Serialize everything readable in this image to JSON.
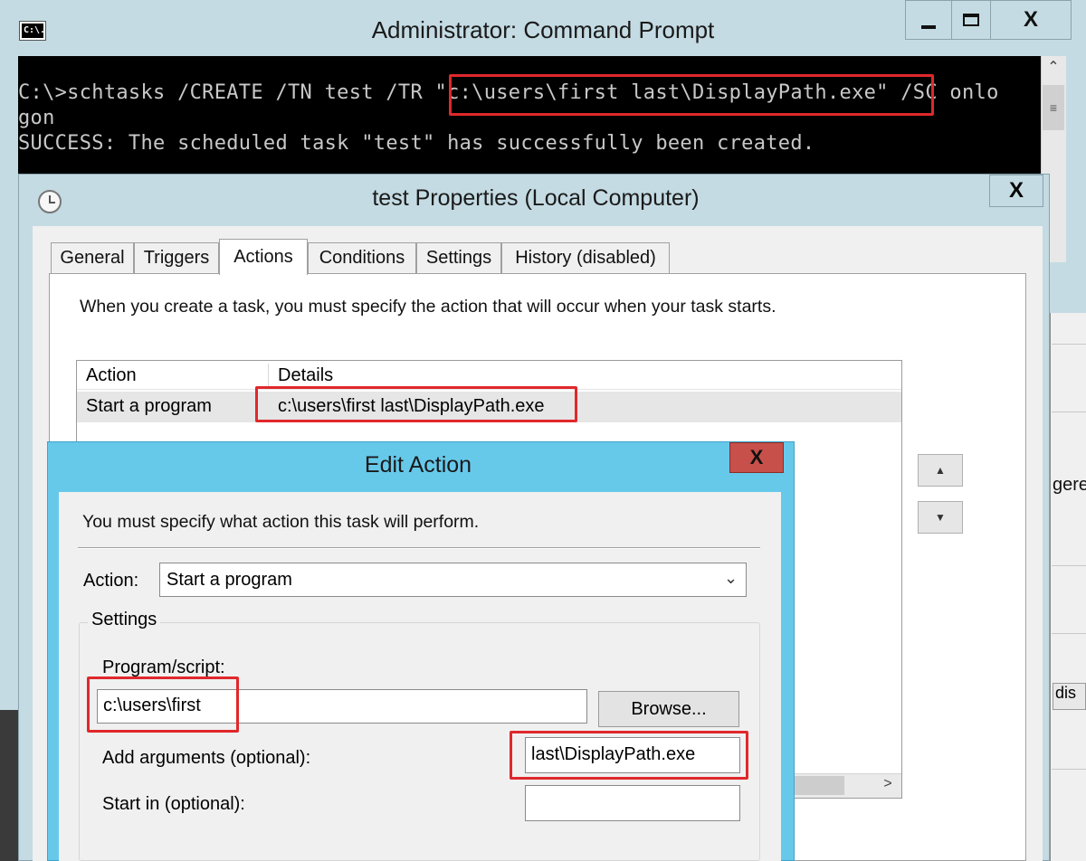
{
  "cmd": {
    "title": "Administrator: Command Prompt",
    "icon_text": "C:\\.",
    "console_lines": [
      "C:\\>schtasks /CREATE /TN test /TR \"c:\\users\\first last\\DisplayPath.exe\" /SC onlo",
      "gon",
      "SUCCESS: The scheduled task \"test\" has successfully been created."
    ],
    "close_glyph": "X"
  },
  "props": {
    "title": "test Properties (Local Computer)",
    "close_glyph": "X",
    "tabs": [
      {
        "label": "General"
      },
      {
        "label": "Triggers"
      },
      {
        "label": "Actions"
      },
      {
        "label": "Conditions"
      },
      {
        "label": "Settings"
      },
      {
        "label": "History (disabled)"
      }
    ],
    "active_tab": "Actions",
    "description": "When you create a task, you must specify the action that will occur when your task starts.",
    "list": {
      "columns": [
        "Action",
        "Details"
      ],
      "rows": [
        {
          "action": "Start a program",
          "details": "c:\\users\\first last\\DisplayPath.exe"
        }
      ]
    }
  },
  "edit": {
    "title": "Edit Action",
    "close_glyph": "X",
    "description": "You must specify what action this task will perform.",
    "action_label": "Action:",
    "action_value": "Start a program",
    "settings_legend": "Settings",
    "program_label": "Program/script:",
    "program_value": "c:\\users\\first",
    "browse_label": "Browse...",
    "args_label": "Add arguments (optional):",
    "args_value": "last\\DisplayPath.exe",
    "startin_label": "Start in (optional):",
    "startin_value": ""
  },
  "background_window": {
    "fragment_1": "gere",
    "fragment_2": "dis"
  },
  "colors": {
    "highlight": "#e0282b",
    "window_frame": "#c4dbe3",
    "dialog_frame": "#67c9ea",
    "close_red": "#c7504a"
  },
  "icons": [
    "cmd-icon",
    "clock-icon",
    "minimize-icon",
    "maximize-icon",
    "close-icon",
    "chevron-down-icon",
    "arrow-up-icon",
    "arrow-down-icon"
  ]
}
